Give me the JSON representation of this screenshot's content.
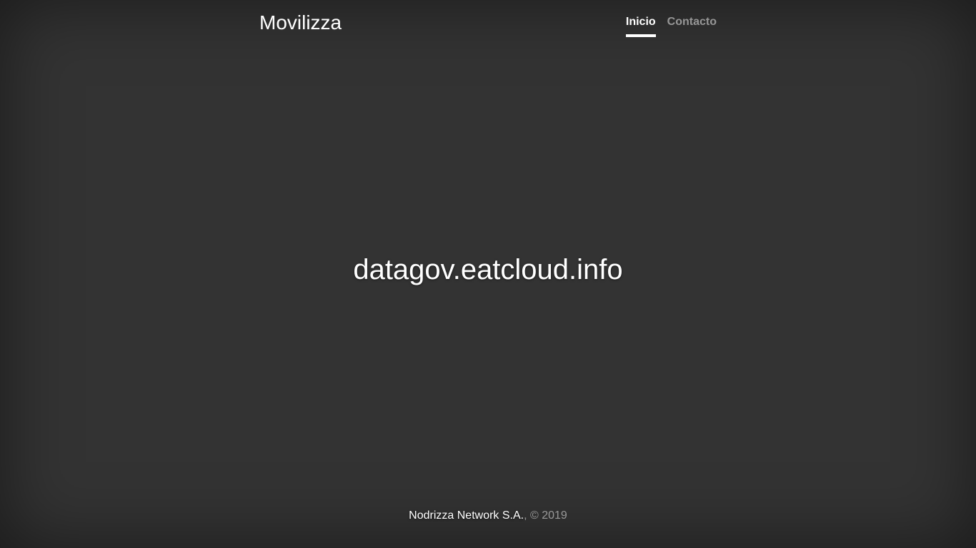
{
  "header": {
    "brand": "Movilizza",
    "nav": [
      {
        "label": "Inicio",
        "active": true
      },
      {
        "label": "Contacto",
        "active": false
      }
    ]
  },
  "main": {
    "heading": "datagov.eatcloud.info"
  },
  "footer": {
    "company": "Nodrizza Network S.A.",
    "copyright": ", © 2019"
  },
  "colors": {
    "background": "#333333",
    "text": "#ffffff",
    "muted_text": "rgba(255,255,255,0.5)"
  }
}
